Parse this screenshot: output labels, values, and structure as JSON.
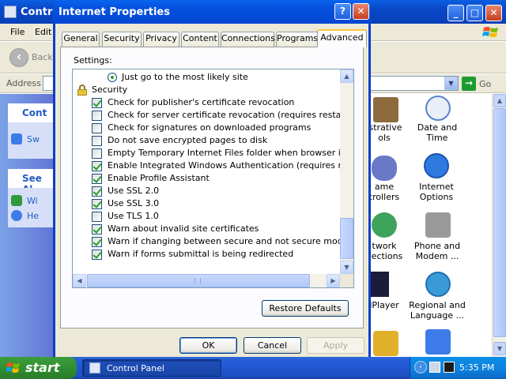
{
  "control_panel": {
    "title": "Control Panel",
    "menu": [
      "File",
      "Edit"
    ],
    "back_label": "Back",
    "address_label": "Address",
    "go_label": "Go",
    "side_pane": {
      "task_heading": "Cont",
      "task_item": "Sw",
      "see_also_heading": "See Al",
      "see_also_items": [
        "Wi",
        "He"
      ]
    },
    "items": [
      {
        "label": "Administrative Tools",
        "shown_lines": [
          "istrative",
          "ols"
        ]
      },
      {
        "label": "Date and Time",
        "shown_lines": [
          "Date and Time"
        ]
      },
      {
        "label": "Game Controllers",
        "shown_lines": [
          "ame",
          "trollers"
        ]
      },
      {
        "label": "Internet Options",
        "shown_lines": [
          "Internet",
          "Options"
        ]
      },
      {
        "label": "Network Connections",
        "shown_lines": [
          "twork",
          "nections"
        ]
      },
      {
        "label": "Phone and Modem ...",
        "shown_lines": [
          "Phone and",
          "Modem ..."
        ]
      },
      {
        "label": "RealPlayer",
        "shown_lines": [
          "lPlayer"
        ]
      },
      {
        "label": "Regional and Language ...",
        "shown_lines": [
          "Regional and",
          "Language ..."
        ]
      }
    ]
  },
  "dialog": {
    "title": "Internet Properties",
    "help_label": "?",
    "close_label": "✕",
    "tabs": [
      "General",
      "Security",
      "Privacy",
      "Content",
      "Connections",
      "Programs",
      "Advanced"
    ],
    "active_tab": "Advanced",
    "settings_label": "Settings:",
    "settings": [
      {
        "type": "radio",
        "label": "Just go to the most likely site",
        "checked": true
      },
      {
        "type": "group",
        "label": "Security",
        "icon": "lock-icon"
      },
      {
        "type": "checkbox",
        "label": "Check for publisher's certificate revocation",
        "checked": true
      },
      {
        "type": "checkbox",
        "label": "Check for server certificate revocation (requires restart)",
        "checked": false
      },
      {
        "type": "checkbox",
        "label": "Check for signatures on downloaded programs",
        "checked": false
      },
      {
        "type": "checkbox",
        "label": "Do not save encrypted pages to disk",
        "checked": false
      },
      {
        "type": "checkbox",
        "label": "Empty Temporary Internet Files folder when browser is closed",
        "checked": false
      },
      {
        "type": "checkbox",
        "label": "Enable Integrated Windows Authentication (requires restart)",
        "checked": true
      },
      {
        "type": "checkbox",
        "label": "Enable Profile Assistant",
        "checked": true
      },
      {
        "type": "checkbox",
        "label": "Use SSL 2.0",
        "checked": true
      },
      {
        "type": "checkbox",
        "label": "Use SSL 3.0",
        "checked": true
      },
      {
        "type": "checkbox",
        "label": "Use TLS 1.0",
        "checked": false
      },
      {
        "type": "checkbox",
        "label": "Warn about invalid site certificates",
        "checked": true
      },
      {
        "type": "checkbox",
        "label": "Warn if changing between secure and not secure mode",
        "checked": true
      },
      {
        "type": "checkbox",
        "label": "Warn if forms submittal is being redirected",
        "checked": true
      }
    ],
    "restore_defaults_label": "Restore Defaults",
    "ok_label": "OK",
    "cancel_label": "Cancel",
    "apply_label": "Apply"
  },
  "taskbar": {
    "start_label": "start",
    "task_label": "Control Panel",
    "clock": "5:35 PM"
  },
  "colors": {
    "title_blue": "#0553e0",
    "start_green": "#2f8b2f",
    "check_green": "#21a121"
  }
}
